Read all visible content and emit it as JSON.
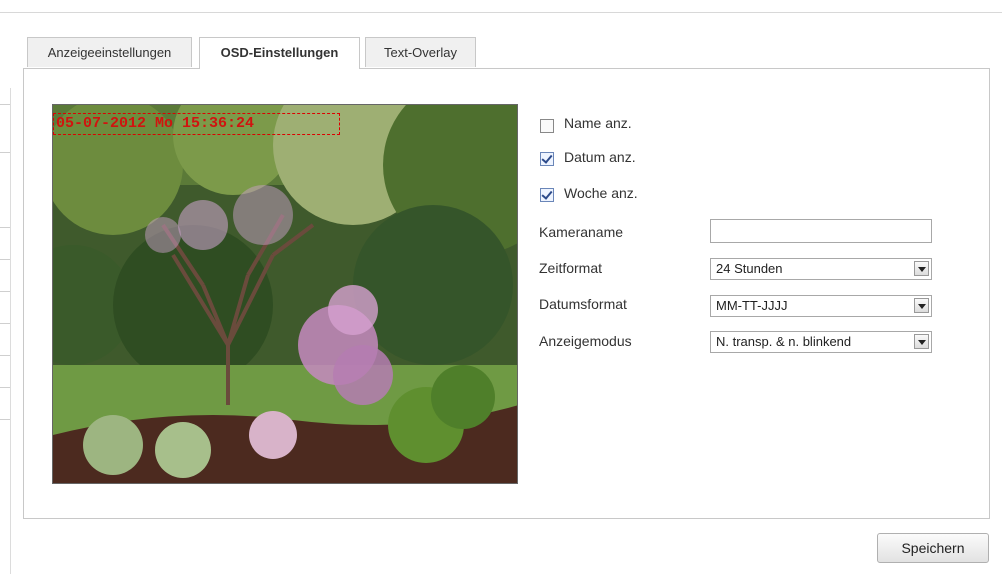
{
  "tabs": [
    {
      "label": "Anzeigeeinstellungen",
      "active": false
    },
    {
      "label": "OSD-Einstellungen",
      "active": true
    },
    {
      "label": "Text-Overlay",
      "active": false
    }
  ],
  "preview": {
    "osd_text": "05-07-2012 Mo 15:36:24"
  },
  "options": {
    "show_name": {
      "label": "Name anz.",
      "checked": false
    },
    "show_date": {
      "label": "Datum anz.",
      "checked": true
    },
    "show_week": {
      "label": "Woche anz.",
      "checked": true
    }
  },
  "fields": {
    "camera_name": {
      "label": "Kameraname",
      "value": ""
    },
    "time_format": {
      "label": "Zeitformat",
      "value": "24 Stunden"
    },
    "date_format": {
      "label": "Datumsformat",
      "value": "MM-TT-JJJJ"
    },
    "display_mode": {
      "label": "Anzeigemodus",
      "value": "N. transp. & n. blinkend"
    }
  },
  "actions": {
    "save_label": "Speichern"
  },
  "colors": {
    "osd_text": "#d0140f",
    "border": "#c8c8c8"
  }
}
